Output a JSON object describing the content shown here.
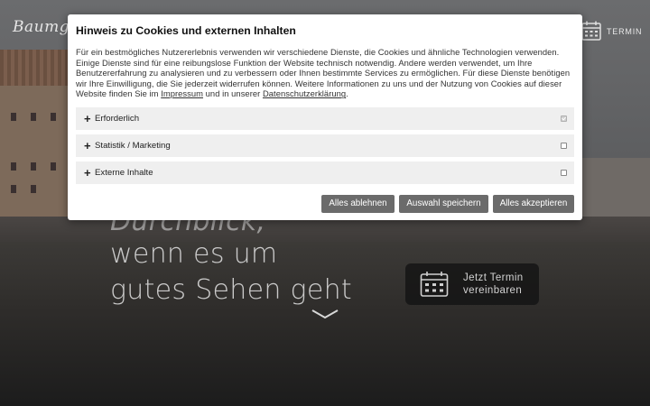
{
  "header": {
    "logo_text": "Baumgar",
    "termin_label": "TERMIN",
    "calendar_icon": "calendar-icon"
  },
  "hero": {
    "tagline_partial": "Durchblick,",
    "tagline_line1": "wenn es um",
    "tagline_line2": "gutes Sehen geht",
    "cta_line1": "Jetzt Termin",
    "cta_line2": "vereinbaren"
  },
  "cookie_dialog": {
    "title": "Hinweis zu Cookies und externen Inhalten",
    "text_before_impressum": "Für ein bestmögliches Nutzererlebnis verwenden wir verschiedene Dienste, die Cookies und ähnliche Technologien verwenden. Einige Dienste sind für eine reibungslose Funktion der Website technisch notwendig. Andere werden verwendet, um Ihre Benutzererfahrung zu analysieren und zu verbessern oder Ihnen bestimmte Services zu ermöglichen. Für diese Dienste benötigen wir Ihre Einwilligung, die Sie jederzeit widerrufen können. Weitere Informationen zu uns und der Nutzung von Cookies auf dieser Website finden Sie im",
    "impressum_link": "Impressum",
    "text_between": "und in unserer",
    "privacy_link": "Datenschutzerklärung",
    "text_end": ".",
    "categories": [
      {
        "label": "Erforderlich",
        "checked": true,
        "disabled": true
      },
      {
        "label": "Statistik / Marketing",
        "checked": false,
        "disabled": false
      },
      {
        "label": "Externe Inhalte",
        "checked": false,
        "disabled": false
      }
    ],
    "expand_symbol": "+",
    "buttons": {
      "reject": "Alles ablehnen",
      "save": "Auswahl speichern",
      "accept": "Alles akzeptieren"
    },
    "button_color": "#6b6b6b"
  }
}
